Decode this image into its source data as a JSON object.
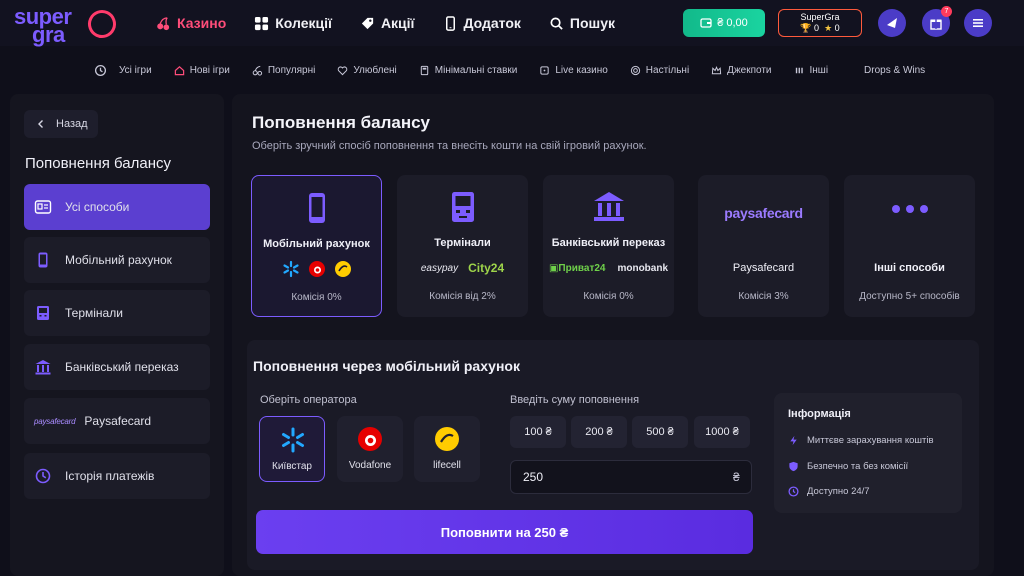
{
  "logo": {
    "line1": "super",
    "line2": "gra"
  },
  "nav": [
    {
      "label": "Казино",
      "icon": "cherry-icon",
      "active": true
    },
    {
      "label": "Колекції",
      "icon": "grid-icon"
    },
    {
      "label": "Акції",
      "icon": "tag-icon"
    },
    {
      "label": "Додаток",
      "icon": "phone-icon"
    },
    {
      "label": "Пошук",
      "icon": "search-icon"
    }
  ],
  "balance": "₴ 0,00",
  "profile": {
    "name": "SuperGra",
    "trophies": "0",
    "stars": "0"
  },
  "notifications_count": "7",
  "subnav": [
    {
      "label": "Усі ігри"
    },
    {
      "label": "Нові ігри"
    },
    {
      "label": "Популярні"
    },
    {
      "label": "Улюблені"
    },
    {
      "label": "Мінімальні ставки"
    },
    {
      "label": "Live казино"
    },
    {
      "label": "Настільні"
    },
    {
      "label": "Джекпоти"
    },
    {
      "label": "Інші"
    },
    {
      "label": "Drops & Wins"
    }
  ],
  "sidebar": {
    "back_label": "Назад",
    "title": "Поповнення балансу",
    "items": [
      {
        "label": "Усі способи"
      },
      {
        "label": "Мобільний рахунок"
      },
      {
        "label": "Термінали"
      },
      {
        "label": "Банківський переказ"
      },
      {
        "label": "Paysafecard",
        "logo": "paysafecard"
      },
      {
        "label": "Історія платежів"
      }
    ]
  },
  "main": {
    "title": "Поповнення балансу",
    "subtitle": "Оберіть зручний спосіб поповнення та внесіть кошти на свій ігровий рахунок.",
    "cards": [
      {
        "title": "Мобільний рахунок",
        "fee": "Комісія 0%"
      },
      {
        "title": "Термінали",
        "fee": "Комісія від 2%",
        "logo1": "easypay",
        "logo2": "City24"
      },
      {
        "title": "Банківський переказ",
        "fee": "Комісія 0%",
        "logo1": "Приват24",
        "logo2": "monobank"
      },
      {
        "title": "Paysafecard",
        "fee": "Комісія 3%",
        "logo": "paysafecard"
      },
      {
        "title": "Інші способи",
        "fee": "Доступно 5+ способів"
      }
    ]
  },
  "panel": {
    "title": "Поповнення через мобільний рахунок",
    "operator_label": "Оберіть оператора",
    "operators": [
      {
        "name": "Київстар"
      },
      {
        "name": "Vodafone"
      },
      {
        "name": "lifecell"
      }
    ],
    "amount_label": "Введіть суму поповнення",
    "amounts": [
      "100 ₴",
      "200 ₴",
      "500 ₴",
      "1000 ₴"
    ],
    "amount_value": "250",
    "currency": "₴",
    "info": {
      "title": "Інформація",
      "rows": [
        "Миттєве зарахування коштів",
        "Безпечно та без комісії",
        "Доступно 24/7"
      ]
    },
    "submit_label": "Поповнити на 250 ₴"
  }
}
